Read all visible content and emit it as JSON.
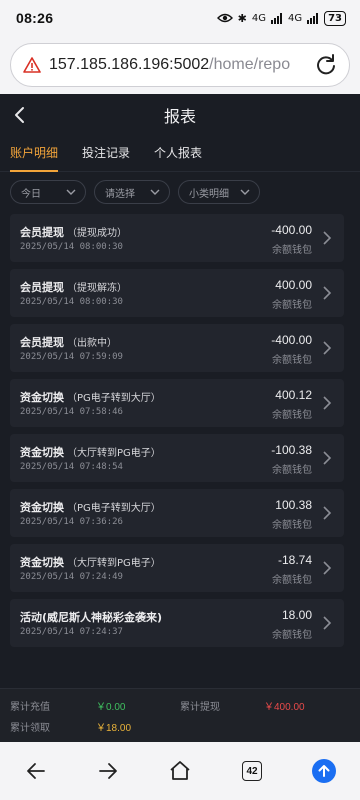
{
  "status": {
    "time": "08:26",
    "net1": "4G",
    "net2": "4G",
    "battery": "73"
  },
  "browser": {
    "url_host": "157.185.186.196:5002",
    "url_path": "/home/repo",
    "tab_count": "42"
  },
  "header": {
    "title": "报表"
  },
  "tabs": [
    {
      "label": "账户明细",
      "active": true
    },
    {
      "label": "投注记录",
      "active": false
    },
    {
      "label": "个人报表",
      "active": false
    }
  ],
  "filters": [
    {
      "value": "今日"
    },
    {
      "value": "请选择"
    },
    {
      "value": "小类明细"
    }
  ],
  "records": [
    {
      "title": "会员提现",
      "sub": "（提现成功）",
      "date": "2025/05/14 08:00:30",
      "amount": "-400.00",
      "wallet": "余额钱包"
    },
    {
      "title": "会员提现",
      "sub": "（提现解冻）",
      "date": "2025/05/14 08:00:30",
      "amount": "400.00",
      "wallet": "余额钱包"
    },
    {
      "title": "会员提现",
      "sub": "（出款中）",
      "date": "2025/05/14 07:59:09",
      "amount": "-400.00",
      "wallet": "余额钱包"
    },
    {
      "title": "资金切换",
      "sub": "（PG电子转到大厅）",
      "date": "2025/05/14 07:58:46",
      "amount": "400.12",
      "wallet": "余额钱包"
    },
    {
      "title": "资金切换",
      "sub": "（大厅转到PG电子）",
      "date": "2025/05/14 07:48:54",
      "amount": "-100.38",
      "wallet": "余额钱包"
    },
    {
      "title": "资金切换",
      "sub": "（PG电子转到大厅）",
      "date": "2025/05/14 07:36:26",
      "amount": "100.38",
      "wallet": "余额钱包"
    },
    {
      "title": "资金切换",
      "sub": "（大厅转到PG电子）",
      "date": "2025/05/14 07:24:49",
      "amount": "-18.74",
      "wallet": "余额钱包"
    },
    {
      "title": "活动(威尼斯人神秘彩金袭来)",
      "sub": "",
      "date": "2025/05/14 07:24:37",
      "amount": "18.00",
      "wallet": "余额钱包"
    }
  ],
  "summary": {
    "deposit_label": "累计充值",
    "deposit_value": "￥0.00",
    "withdraw_label": "累计提现",
    "withdraw_value": "￥400.00",
    "bonus_label": "累计领取",
    "bonus_value": "￥18.00"
  },
  "colors": {
    "accent": "#f2a43a",
    "positive": "#3fbf5f",
    "negative": "#e84a4a",
    "gold": "#e8b23a",
    "bg": "#1a1d24",
    "card": "#22252d"
  },
  "icons": [
    "warning-icon",
    "reload-icon",
    "back-icon",
    "chevron-down-icon",
    "chevron-right-icon",
    "arrow-left-icon",
    "arrow-right-icon",
    "home-icon",
    "tabs-icon",
    "arrow-up-icon"
  ]
}
